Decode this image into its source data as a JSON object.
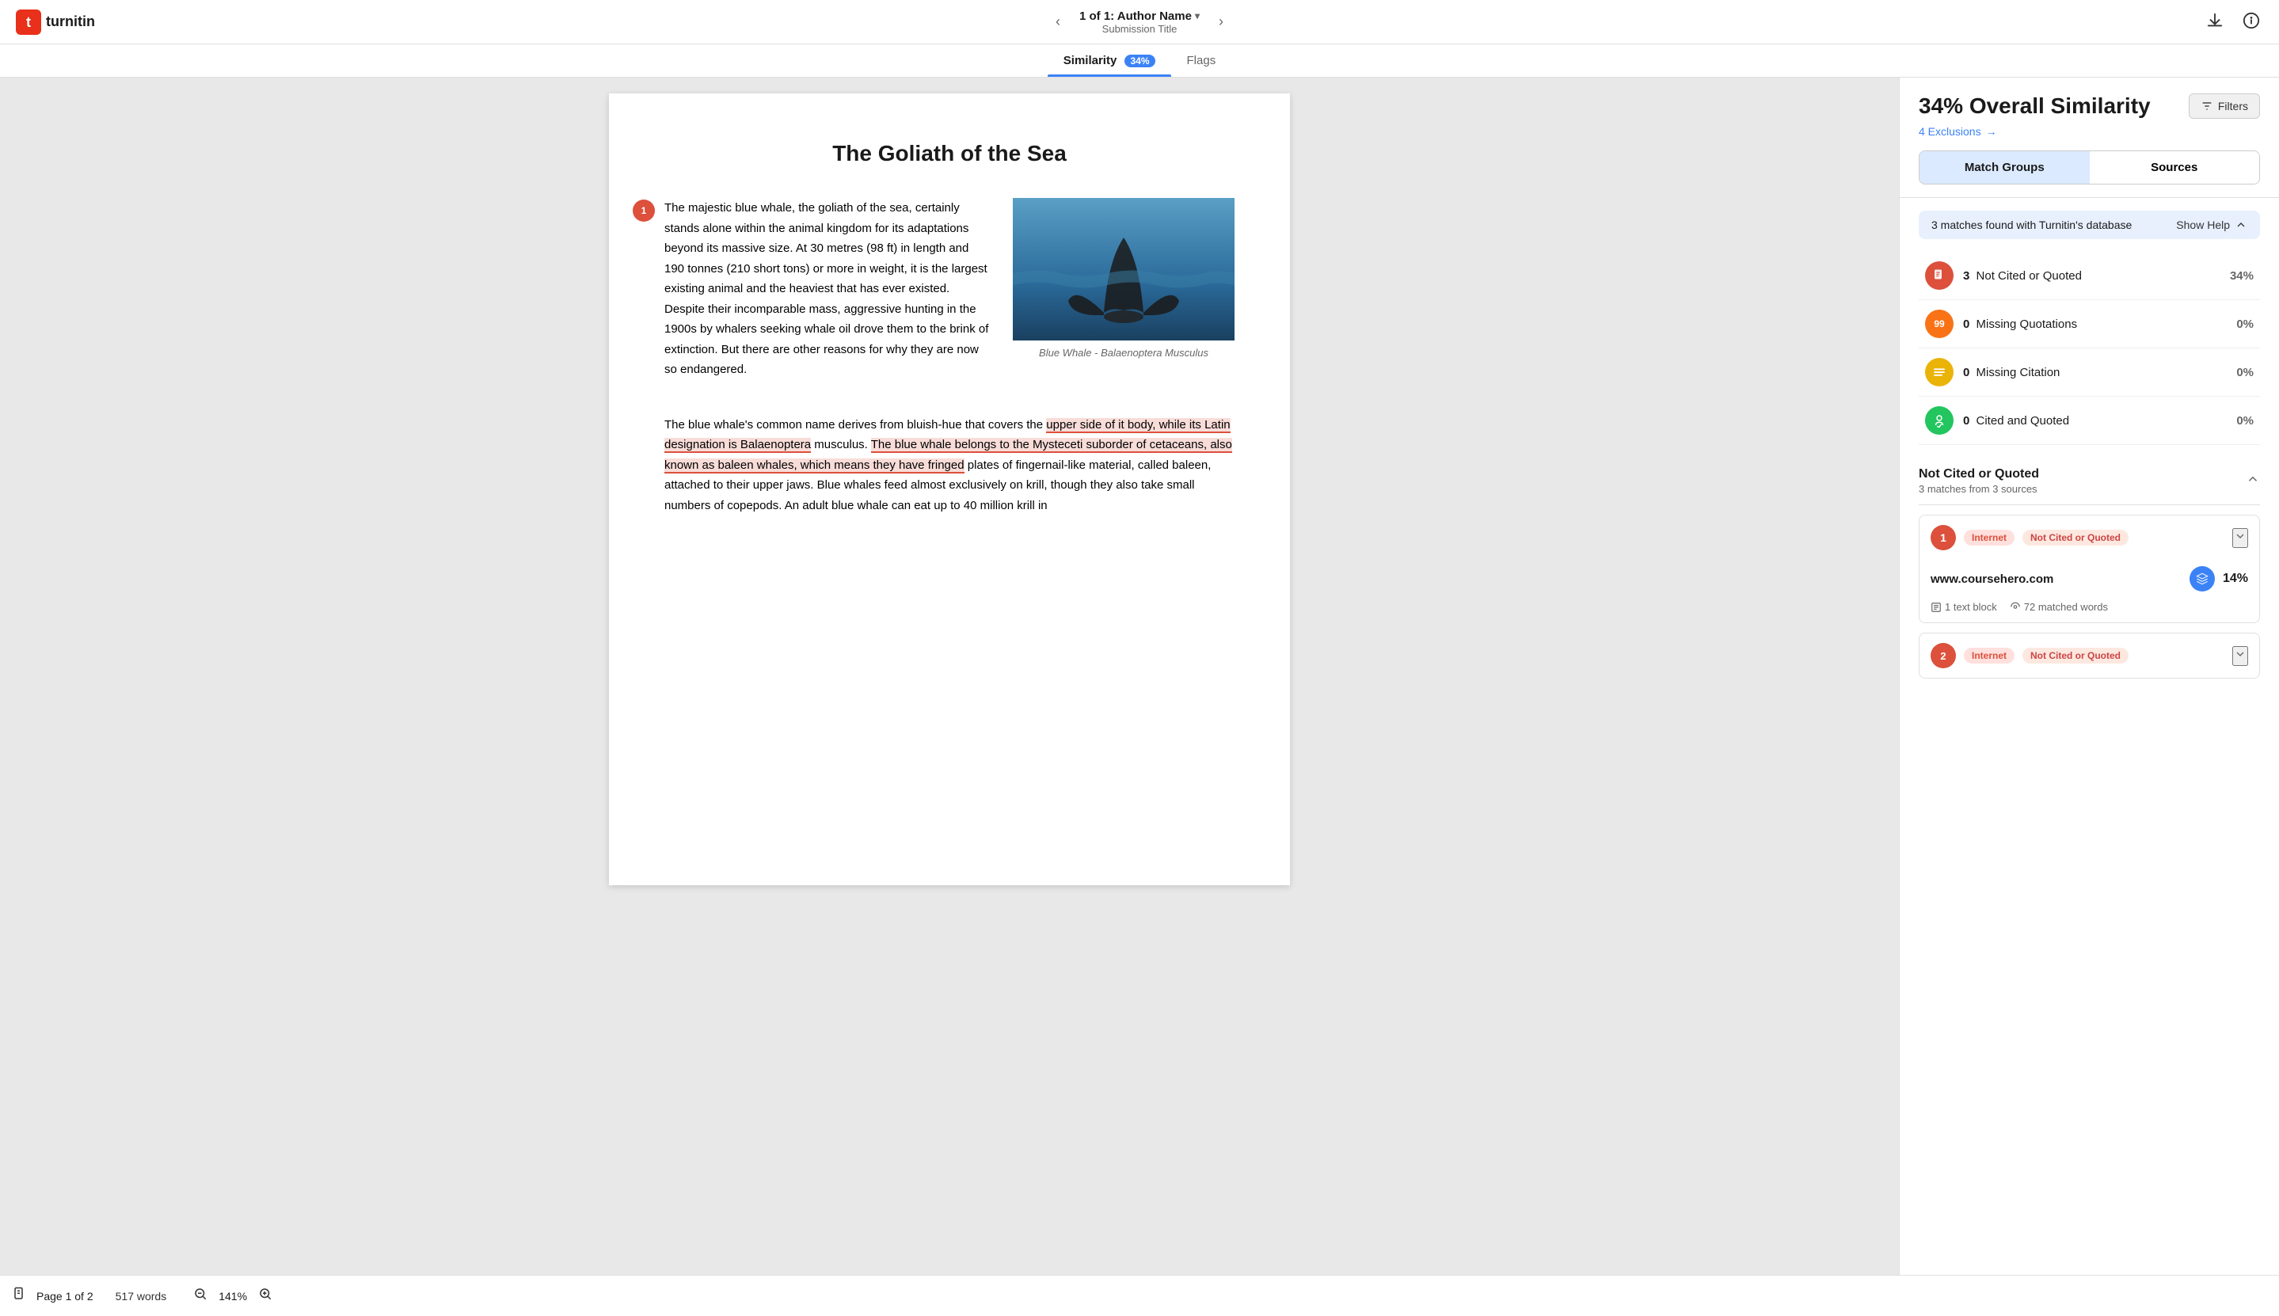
{
  "header": {
    "logo_text": "turnitin",
    "nav_prev": "‹",
    "nav_next": "›",
    "submission_nav": "1 of 1: Author Name",
    "submission_title": "Submission Title",
    "dropdown_char": "▾"
  },
  "tabs": [
    {
      "id": "similarity",
      "label": "Similarity",
      "badge": "34%",
      "active": true
    },
    {
      "id": "flags",
      "label": "Flags",
      "badge": null,
      "active": false
    }
  ],
  "document": {
    "title": "The Goliath of the Sea",
    "paragraph1": "The majestic blue whale, the goliath of the sea, certainly stands alone within the animal kingdom for its adaptations beyond its massive size. At 30 metres (98 ft) in length and 190 tonnes (210 short tons) or more in weight, it is the largest existing animal and the heaviest that has ever existed. Despite their incomparable mass, aggressive hunting in the 1900s by whalers seeking whale oil drove them to the brink of extinction. But there are other reasons for why they are now so endangered.",
    "image_caption": "Blue Whale - Balaenoptera Musculus",
    "paragraph2_prefix": "The blue whale's common name derives from bluish-hue that covers the ",
    "paragraph2_highlight1": "upper side of it body, while its Latin designation is Balaenoptera",
    "paragraph2_mid": " musculus. ",
    "paragraph2_highlight2": "The blue whale belongs to the Mysteceti suborder of cetaceans, also known as baleen whales, which means they have fringed",
    "paragraph2_suffix": " plates of fingernail-like material, called baleen, attached to their upper jaws. Blue whales feed almost exclusively on krill, though they also take small numbers of copepods. An adult blue whale can eat up to 40 million krill in"
  },
  "right_panel": {
    "similarity_pct": "34% Overall Similarity",
    "exclusions_text": "4 Exclusions",
    "filters_label": "Filters",
    "match_tabs": [
      {
        "label": "Match Groups",
        "active": true
      },
      {
        "label": "Sources",
        "active": false
      }
    ],
    "matches_info": "3 matches found with Turnitin's database",
    "show_help": "Show Help",
    "match_types": [
      {
        "icon_type": "red",
        "icon_content": "📄",
        "count": "3",
        "label": "Not Cited or Quoted",
        "pct": "34%"
      },
      {
        "icon_type": "orange",
        "icon_content": "99",
        "count": "0",
        "label": "Missing Quotations",
        "pct": "0%"
      },
      {
        "icon_type": "yellow",
        "icon_content": "≡",
        "count": "0",
        "label": "Missing Citation",
        "pct": "0%"
      },
      {
        "icon_type": "green",
        "icon_content": "🎓",
        "count": "0",
        "label": "Cited and Quoted",
        "pct": "0%"
      }
    ],
    "not_cited_section": {
      "title": "Not Cited or Quoted",
      "subtitle": "3 matches from 3 sources"
    },
    "sources": [
      {
        "num": "1",
        "tags": [
          "Internet",
          "Not Cited or Quoted"
        ],
        "url": "www.coursehero.com",
        "pct": "14%",
        "text_blocks": "1 text block",
        "matched_words": "72 matched words"
      },
      {
        "num": "2",
        "tags": [
          "Internet",
          "Not Cited or Quoted"
        ],
        "url": "",
        "pct": "",
        "text_blocks": "",
        "matched_words": ""
      }
    ]
  },
  "bottom_bar": {
    "page_label": "Page 1 of 2",
    "word_count": "517 words",
    "zoom_level": "141%"
  },
  "icons": {
    "download": "⬇",
    "info": "ℹ",
    "filter": "⊟",
    "arrow_right": "→",
    "chevron_up": "∧",
    "chevron_down": "∨",
    "zoom_in": "+",
    "zoom_out": "−",
    "page": "📄"
  }
}
